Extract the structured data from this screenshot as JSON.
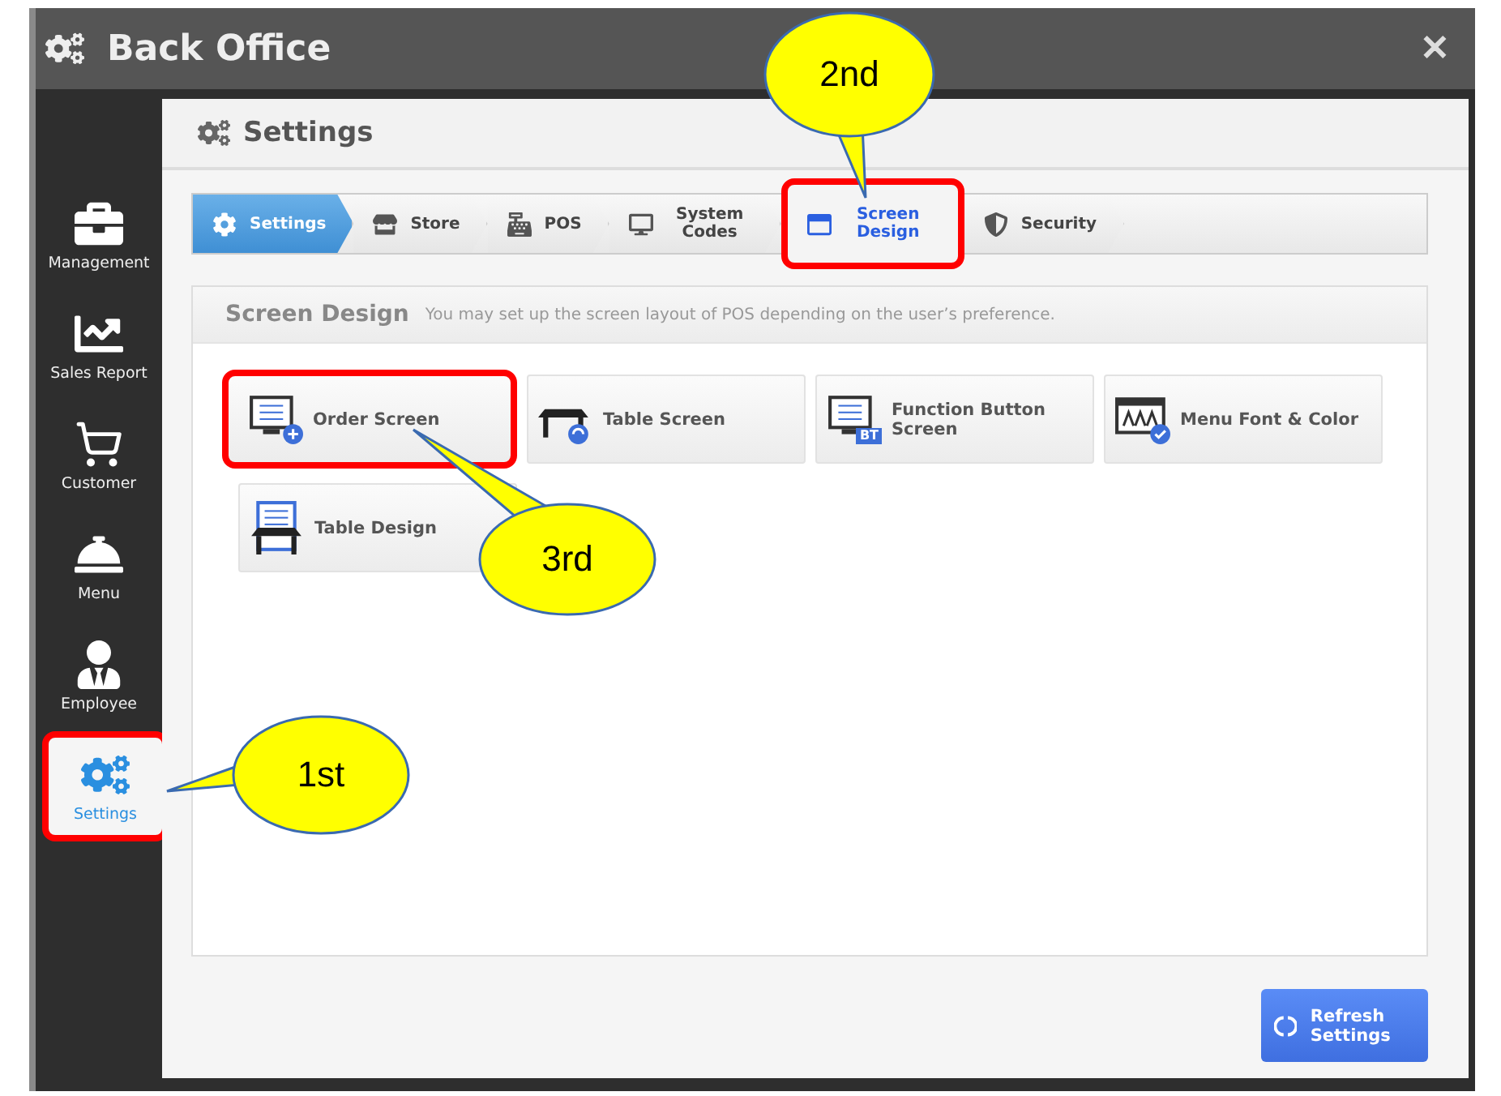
{
  "window": {
    "title": "Back Office",
    "close": "✕"
  },
  "sidebar": {
    "items": [
      {
        "label": "Management",
        "selected": false,
        "highlighted": false
      },
      {
        "label": "Sales Report",
        "selected": false,
        "highlighted": false
      },
      {
        "label": "Customer",
        "selected": false,
        "highlighted": false
      },
      {
        "label": "Menu",
        "selected": false,
        "highlighted": false
      },
      {
        "label": "Employee",
        "selected": false,
        "highlighted": false
      },
      {
        "label": "Settings",
        "selected": true,
        "highlighted": true
      }
    ]
  },
  "page": {
    "title": "Settings"
  },
  "steps": [
    {
      "label": "Settings",
      "filled": true,
      "selected": false,
      "highlighted": false
    },
    {
      "label": "Store",
      "filled": false,
      "selected": false,
      "highlighted": false
    },
    {
      "label": "POS",
      "filled": false,
      "selected": false,
      "highlighted": false
    },
    {
      "label": "System Codes",
      "filled": false,
      "selected": false,
      "highlighted": false
    },
    {
      "label": "Screen Design",
      "filled": false,
      "selected": true,
      "highlighted": true
    },
    {
      "label": "Security",
      "filled": false,
      "selected": false,
      "highlighted": false
    }
  ],
  "section": {
    "title": "Screen Design",
    "hint": "You may set up the screen layout of POS depending on the user’s preference."
  },
  "tiles": [
    {
      "label": "Order Screen",
      "highlighted": true
    },
    {
      "label": "Table Screen",
      "highlighted": false
    },
    {
      "label": "Function Button Screen",
      "icon_badge": "BT",
      "highlighted": false
    },
    {
      "label": "Menu Font & Color",
      "highlighted": false
    },
    {
      "label": "Table Design",
      "highlighted": false
    }
  ],
  "refresh_button": {
    "label": "Refresh Settings"
  },
  "callouts": [
    {
      "label": "2nd"
    },
    {
      "label": "3rd"
    },
    {
      "label": "1st"
    }
  ]
}
